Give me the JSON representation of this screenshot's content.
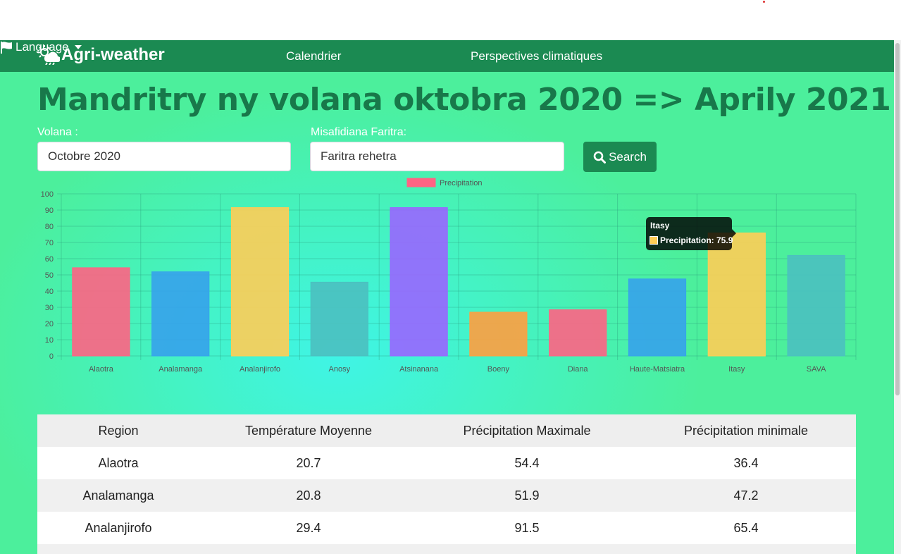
{
  "navbar": {
    "brand": "Agri-weather",
    "links": [
      "Calendrier",
      "Perspectives climatiques"
    ],
    "language": "Language"
  },
  "page": {
    "title": "Mandritry ny volana oktobra 2020 => Aprily 2021"
  },
  "form": {
    "volana_label": "Volana :",
    "volana_value": "Octobre 2020",
    "faritra_label": "Misafidiana Faritra:",
    "faritra_value": "Faritra rehetra",
    "search_label": "Search"
  },
  "chart_data": {
    "type": "bar",
    "categories": [
      "Alaotra",
      "Analamanga",
      "Analanjirofo",
      "Anosy",
      "Atsinanana",
      "Boeny",
      "Diana",
      "Haute-Matsiatra",
      "Itasy",
      "SAVA"
    ],
    "series": [
      {
        "name": "Precipitation",
        "values": [
          54.4,
          51.9,
          91.5,
          45.5,
          91.5,
          27,
          28.5,
          47.5,
          75.9,
          62
        ]
      }
    ],
    "colors": [
      "#ff6384",
      "#36a2eb",
      "#ffcd56",
      "#4bc0c0",
      "#9966ff",
      "#ff9f40",
      "#ff6384",
      "#36a2eb",
      "#ffcd56",
      "#4bc0c0"
    ],
    "legend_swatch_color": "#ff6384",
    "ylim": [
      0,
      100
    ],
    "yticks": [
      0,
      10,
      20,
      30,
      40,
      50,
      60,
      70,
      80,
      90,
      100
    ],
    "grid": true,
    "legend": "top",
    "tooltip": {
      "title": "Itasy",
      "label": "Precipitation: 75.9"
    }
  },
  "table": {
    "headers": [
      "Region",
      "Température Moyenne",
      "Précipitation Maximale",
      "Précipitation minimale"
    ],
    "rows": [
      [
        "Alaotra",
        "20.7",
        "54.4",
        "36.4"
      ],
      [
        "Analamanga",
        "20.8",
        "51.9",
        "47.2"
      ],
      [
        "Analanjirofo",
        "29.4",
        "91.5",
        "65.4"
      ]
    ]
  },
  "colors": {
    "navbar": "#1b8a52",
    "title": "#18784a"
  }
}
